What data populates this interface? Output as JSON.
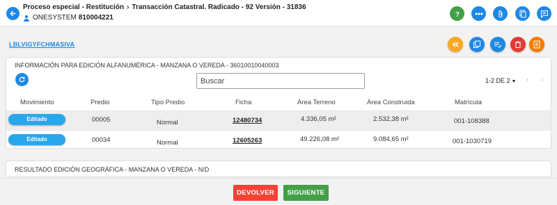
{
  "header": {
    "breadcrumb": [
      "Proceso especial - Restitución",
      "Transacción Catastral. Radicado - 92 Versión - 31836"
    ],
    "user": "ONESYSTEM",
    "user_code": "810004221"
  },
  "toolbar": {
    "icons": [
      "help-icon",
      "workflow-icon",
      "attachment-icon",
      "documents-icon",
      "comments-icon"
    ]
  },
  "main": {
    "link_label": "LBLVIGYFCHMASIVA",
    "actions": [
      {
        "icon": "return-icon",
        "color": "#f9a825"
      },
      {
        "icon": "copy-icon",
        "color": "#1e88e5"
      },
      {
        "icon": "checklist-icon",
        "color": "#1e88e5"
      },
      {
        "icon": "delete-icon",
        "color": "#e53935"
      },
      {
        "icon": "form-icon",
        "color": "#f57c00"
      }
    ]
  },
  "panel": {
    "title": "INFORMACIÓN PARA EDICIÓN ALFANUMÉRICA - MANZANA O VEREDA - 36010010040003",
    "search_placeholder": "Buscar",
    "pagination": "1-2 DE 2"
  },
  "table": {
    "headers": [
      "Movimiento",
      "Predio",
      "Tipo Predio",
      "Ficha",
      "Área Terreno",
      "Área Construida",
      "Matrícula"
    ],
    "rows": [
      {
        "movimiento": "Editado",
        "predio": "00005",
        "tipo_predio": "Normal",
        "ficha": "12480734",
        "area_terreno": "4.336,05 m²",
        "area_construida": "2.532,38 m²",
        "matricula": "001-108388"
      },
      {
        "movimiento": "Editado",
        "predio": "00034",
        "tipo_predio": "Normal",
        "ficha": "12605263",
        "area_terreno": "49.226,08 m²",
        "area_construida": "9.084,65 m²",
        "matricula": "001-1030719"
      }
    ]
  },
  "panel2": {
    "title": "RESULTADO EDICIÓN GEOGRÁFICA - MANZANA O VEREDA - N/D"
  },
  "footer": {
    "return_label": "DEVOLVER",
    "next_label": "SIGUIENTE"
  },
  "colors": {
    "primary": "#1e88e5",
    "pill": "#29a7ec",
    "danger": "#f44336",
    "success": "#43a047"
  }
}
